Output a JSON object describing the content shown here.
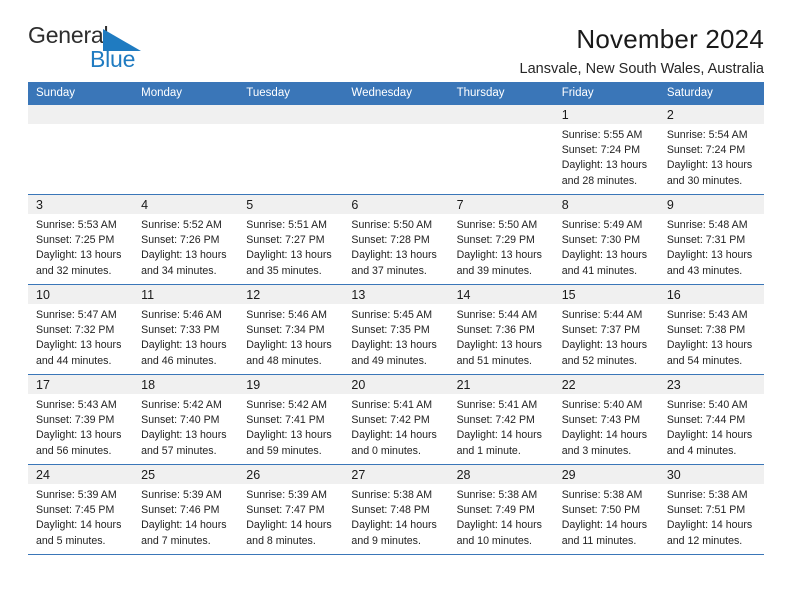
{
  "brand": {
    "name_part1": "General",
    "name_part2": "Blue",
    "triangle_color": "#1f7bc1"
  },
  "header": {
    "title": "November 2024",
    "subtitle": "Lansvale, New South Wales, Australia"
  },
  "theme": {
    "header_bar": "#3a76b8",
    "day_band": "#f0f0f0",
    "text": "#222222"
  },
  "weekdays": [
    "Sunday",
    "Monday",
    "Tuesday",
    "Wednesday",
    "Thursday",
    "Friday",
    "Saturday"
  ],
  "labels": {
    "sunrise": "Sunrise:",
    "sunset": "Sunset:",
    "daylight": "Daylight:"
  },
  "weeks": [
    [
      {
        "day": "",
        "empty": true
      },
      {
        "day": "",
        "empty": true
      },
      {
        "day": "",
        "empty": true
      },
      {
        "day": "",
        "empty": true
      },
      {
        "day": "",
        "empty": true
      },
      {
        "day": "1",
        "sunrise": "Sunrise: 5:55 AM",
        "sunset": "Sunset: 7:24 PM",
        "daylight": "Daylight: 13 hours and 28 minutes."
      },
      {
        "day": "2",
        "sunrise": "Sunrise: 5:54 AM",
        "sunset": "Sunset: 7:24 PM",
        "daylight": "Daylight: 13 hours and 30 minutes."
      }
    ],
    [
      {
        "day": "3",
        "sunrise": "Sunrise: 5:53 AM",
        "sunset": "Sunset: 7:25 PM",
        "daylight": "Daylight: 13 hours and 32 minutes."
      },
      {
        "day": "4",
        "sunrise": "Sunrise: 5:52 AM",
        "sunset": "Sunset: 7:26 PM",
        "daylight": "Daylight: 13 hours and 34 minutes."
      },
      {
        "day": "5",
        "sunrise": "Sunrise: 5:51 AM",
        "sunset": "Sunset: 7:27 PM",
        "daylight": "Daylight: 13 hours and 35 minutes."
      },
      {
        "day": "6",
        "sunrise": "Sunrise: 5:50 AM",
        "sunset": "Sunset: 7:28 PM",
        "daylight": "Daylight: 13 hours and 37 minutes."
      },
      {
        "day": "7",
        "sunrise": "Sunrise: 5:50 AM",
        "sunset": "Sunset: 7:29 PM",
        "daylight": "Daylight: 13 hours and 39 minutes."
      },
      {
        "day": "8",
        "sunrise": "Sunrise: 5:49 AM",
        "sunset": "Sunset: 7:30 PM",
        "daylight": "Daylight: 13 hours and 41 minutes."
      },
      {
        "day": "9",
        "sunrise": "Sunrise: 5:48 AM",
        "sunset": "Sunset: 7:31 PM",
        "daylight": "Daylight: 13 hours and 43 minutes."
      }
    ],
    [
      {
        "day": "10",
        "sunrise": "Sunrise: 5:47 AM",
        "sunset": "Sunset: 7:32 PM",
        "daylight": "Daylight: 13 hours and 44 minutes."
      },
      {
        "day": "11",
        "sunrise": "Sunrise: 5:46 AM",
        "sunset": "Sunset: 7:33 PM",
        "daylight": "Daylight: 13 hours and 46 minutes."
      },
      {
        "day": "12",
        "sunrise": "Sunrise: 5:46 AM",
        "sunset": "Sunset: 7:34 PM",
        "daylight": "Daylight: 13 hours and 48 minutes."
      },
      {
        "day": "13",
        "sunrise": "Sunrise: 5:45 AM",
        "sunset": "Sunset: 7:35 PM",
        "daylight": "Daylight: 13 hours and 49 minutes."
      },
      {
        "day": "14",
        "sunrise": "Sunrise: 5:44 AM",
        "sunset": "Sunset: 7:36 PM",
        "daylight": "Daylight: 13 hours and 51 minutes."
      },
      {
        "day": "15",
        "sunrise": "Sunrise: 5:44 AM",
        "sunset": "Sunset: 7:37 PM",
        "daylight": "Daylight: 13 hours and 52 minutes."
      },
      {
        "day": "16",
        "sunrise": "Sunrise: 5:43 AM",
        "sunset": "Sunset: 7:38 PM",
        "daylight": "Daylight: 13 hours and 54 minutes."
      }
    ],
    [
      {
        "day": "17",
        "sunrise": "Sunrise: 5:43 AM",
        "sunset": "Sunset: 7:39 PM",
        "daylight": "Daylight: 13 hours and 56 minutes."
      },
      {
        "day": "18",
        "sunrise": "Sunrise: 5:42 AM",
        "sunset": "Sunset: 7:40 PM",
        "daylight": "Daylight: 13 hours and 57 minutes."
      },
      {
        "day": "19",
        "sunrise": "Sunrise: 5:42 AM",
        "sunset": "Sunset: 7:41 PM",
        "daylight": "Daylight: 13 hours and 59 minutes."
      },
      {
        "day": "20",
        "sunrise": "Sunrise: 5:41 AM",
        "sunset": "Sunset: 7:42 PM",
        "daylight": "Daylight: 14 hours and 0 minutes."
      },
      {
        "day": "21",
        "sunrise": "Sunrise: 5:41 AM",
        "sunset": "Sunset: 7:42 PM",
        "daylight": "Daylight: 14 hours and 1 minute."
      },
      {
        "day": "22",
        "sunrise": "Sunrise: 5:40 AM",
        "sunset": "Sunset: 7:43 PM",
        "daylight": "Daylight: 14 hours and 3 minutes."
      },
      {
        "day": "23",
        "sunrise": "Sunrise: 5:40 AM",
        "sunset": "Sunset: 7:44 PM",
        "daylight": "Daylight: 14 hours and 4 minutes."
      }
    ],
    [
      {
        "day": "24",
        "sunrise": "Sunrise: 5:39 AM",
        "sunset": "Sunset: 7:45 PM",
        "daylight": "Daylight: 14 hours and 5 minutes."
      },
      {
        "day": "25",
        "sunrise": "Sunrise: 5:39 AM",
        "sunset": "Sunset: 7:46 PM",
        "daylight": "Daylight: 14 hours and 7 minutes."
      },
      {
        "day": "26",
        "sunrise": "Sunrise: 5:39 AM",
        "sunset": "Sunset: 7:47 PM",
        "daylight": "Daylight: 14 hours and 8 minutes."
      },
      {
        "day": "27",
        "sunrise": "Sunrise: 5:38 AM",
        "sunset": "Sunset: 7:48 PM",
        "daylight": "Daylight: 14 hours and 9 minutes."
      },
      {
        "day": "28",
        "sunrise": "Sunrise: 5:38 AM",
        "sunset": "Sunset: 7:49 PM",
        "daylight": "Daylight: 14 hours and 10 minutes."
      },
      {
        "day": "29",
        "sunrise": "Sunrise: 5:38 AM",
        "sunset": "Sunset: 7:50 PM",
        "daylight": "Daylight: 14 hours and 11 minutes."
      },
      {
        "day": "30",
        "sunrise": "Sunrise: 5:38 AM",
        "sunset": "Sunset: 7:51 PM",
        "daylight": "Daylight: 14 hours and 12 minutes."
      }
    ]
  ]
}
